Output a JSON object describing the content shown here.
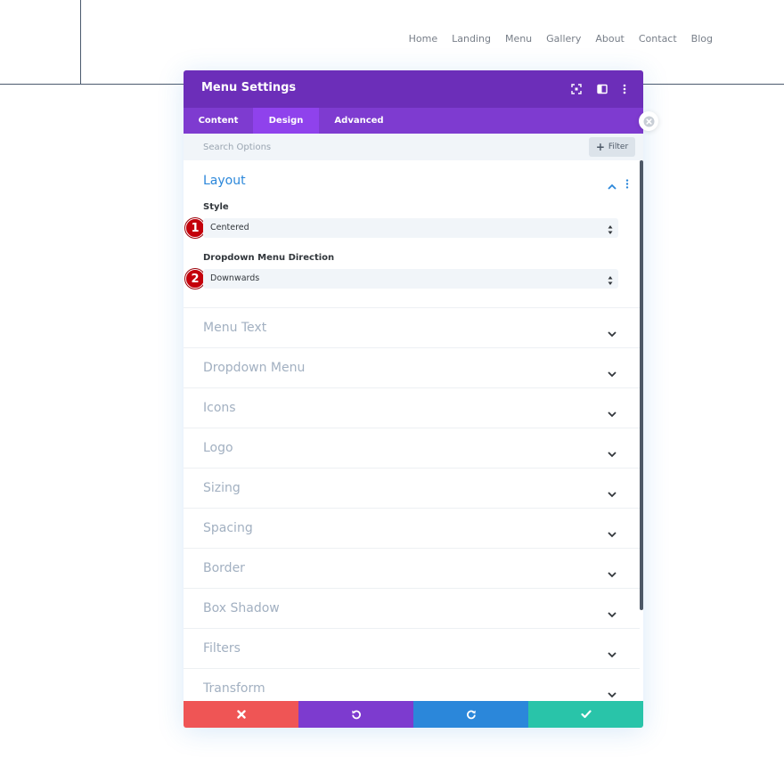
{
  "background": {
    "nav": [
      "Home",
      "Landing",
      "Menu",
      "Gallery",
      "About",
      "Contact",
      "Blog"
    ]
  },
  "modal": {
    "title": "Menu Settings",
    "header_icons": [
      "focus-icon",
      "split-view-icon",
      "more-vertical-icon"
    ],
    "tabs": [
      {
        "label": "Content",
        "active": false
      },
      {
        "label": "Design",
        "active": true
      },
      {
        "label": "Advanced",
        "active": false
      }
    ],
    "search": {
      "placeholder": "Search Options",
      "filter_label": "Filter"
    },
    "layout": {
      "title": "Layout",
      "style": {
        "label": "Style",
        "value": "Centered",
        "badge": "1"
      },
      "direction": {
        "label": "Dropdown Menu Direction",
        "value": "Downwards",
        "badge": "2"
      }
    },
    "groups": [
      "Menu Text",
      "Dropdown Menu",
      "Icons",
      "Logo",
      "Sizing",
      "Spacing",
      "Border",
      "Box Shadow",
      "Filters",
      "Transform"
    ],
    "footer": [
      {
        "icon": "close-icon",
        "color": "#ef5555"
      },
      {
        "icon": "undo-icon",
        "color": "#7d3bcf"
      },
      {
        "icon": "redo-icon",
        "color": "#2b87da"
      },
      {
        "icon": "check-icon",
        "color": "#29c4a9"
      }
    ]
  },
  "colors": {
    "header": "#6c2eb9",
    "tabs": "#7e3bd0",
    "tab_active": "#8f42ec",
    "accent": "#2b87da",
    "badge": "#c4000b"
  }
}
